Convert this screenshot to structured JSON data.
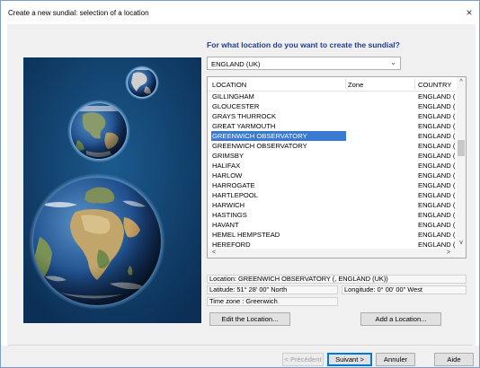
{
  "window": {
    "title": "Create a new sundial: selection of a location",
    "close": "×"
  },
  "question": "For what location do you want to create the sundial?",
  "country_select": {
    "value": "ENGLAND (UK)",
    "arrow": "⌄"
  },
  "list": {
    "headers": {
      "location": "LOCATION",
      "zone": "Zone",
      "country": "COUNTRY"
    },
    "rows": [
      {
        "location": "GILLINGHAM",
        "zone": "",
        "country": "ENGLAND (L"
      },
      {
        "location": "GLOUCESTER",
        "zone": "",
        "country": "ENGLAND (L"
      },
      {
        "location": "GRAYS THURROCK",
        "zone": "",
        "country": "ENGLAND (L"
      },
      {
        "location": "GREAT YARMOUTH",
        "zone": "",
        "country": "ENGLAND (L"
      },
      {
        "location": "GREENWICH OBSERVATORY",
        "zone": "",
        "country": "ENGLAND (L"
      },
      {
        "location": "GREENWICH OBSERVATORY",
        "zone": "",
        "country": "ENGLAND (L"
      },
      {
        "location": "GRIMSBY",
        "zone": "",
        "country": "ENGLAND (L"
      },
      {
        "location": "HALIFAX",
        "zone": "",
        "country": "ENGLAND (L"
      },
      {
        "location": "HARLOW",
        "zone": "",
        "country": "ENGLAND (L"
      },
      {
        "location": "HARROGATE",
        "zone": "",
        "country": "ENGLAND (L"
      },
      {
        "location": "HARTLEPOOL",
        "zone": "",
        "country": "ENGLAND (L"
      },
      {
        "location": "HARWICH",
        "zone": "",
        "country": "ENGLAND (L"
      },
      {
        "location": "HASTINGS",
        "zone": "",
        "country": "ENGLAND (L"
      },
      {
        "location": "HAVANT",
        "zone": "",
        "country": "ENGLAND (L"
      },
      {
        "location": "HEMEL HEMPSTEAD",
        "zone": "",
        "country": "ENGLAND (L"
      },
      {
        "location": "HEREFORD",
        "zone": "",
        "country": "ENGLAND (L"
      }
    ],
    "selected_index": 4,
    "scroll_up": "^",
    "scroll_down": "v",
    "scroll_left": "<",
    "scroll_right": ">"
  },
  "info": {
    "location": "Location:  GREENWICH OBSERVATORY (, ENGLAND (UK))",
    "latitude": "Latitude:  51° 28' 00\" North",
    "longitude": "Longitude:  0° 00' 00\" West",
    "timezone": "Time zone : Greenwich"
  },
  "buttons": {
    "edit_location": "Edit the Location...",
    "add_location": "Add a Location...",
    "previous": "< Précédent",
    "next": "Suivant >",
    "cancel": "Annuler",
    "help": "Aide"
  },
  "colors": {
    "selection": "#3a7ad2",
    "question_text": "#1f3f93",
    "panel_background": "#0e3b66"
  },
  "icons": {
    "close": "close-icon",
    "dropdown": "chevron-down-icon"
  }
}
